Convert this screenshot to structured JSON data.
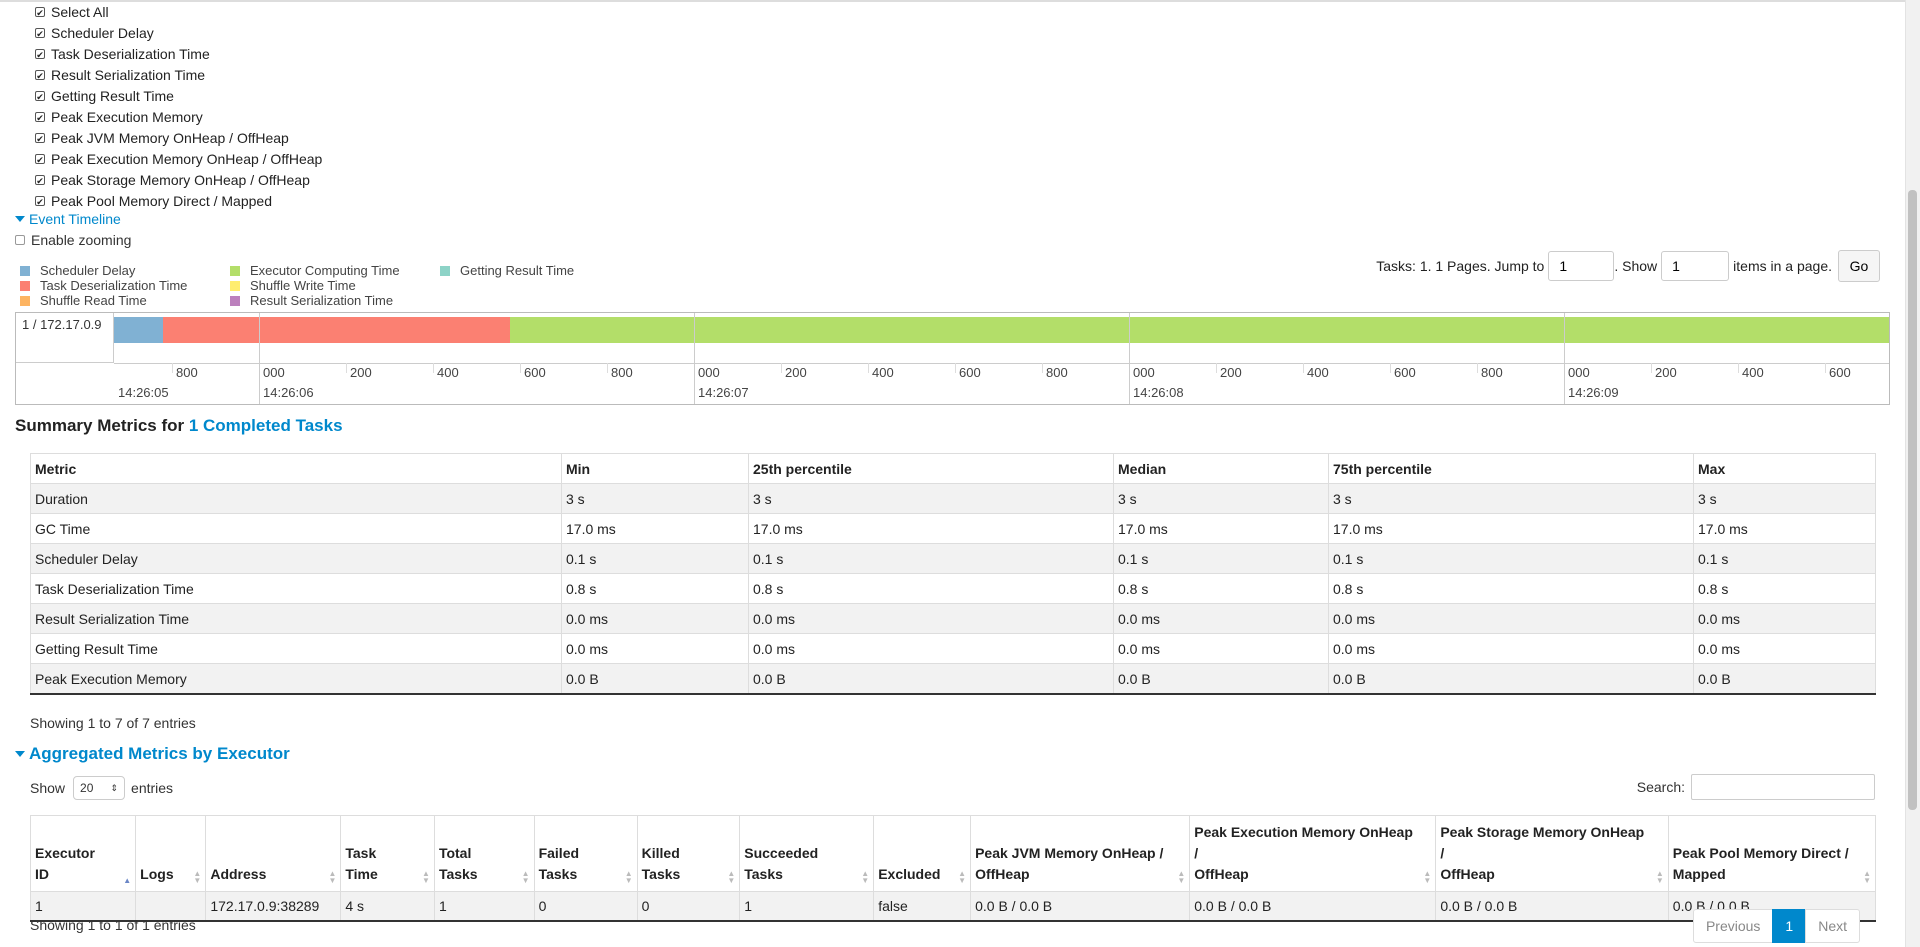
{
  "checkboxes": [
    "Select All",
    "Scheduler Delay",
    "Task Deserialization Time",
    "Result Serialization Time",
    "Getting Result Time",
    "Peak Execution Memory",
    "Peak JVM Memory OnHeap / OffHeap",
    "Peak Execution Memory OnHeap / OffHeap",
    "Peak Storage Memory OnHeap / OffHeap",
    "Peak Pool Memory Direct / Mapped"
  ],
  "event_timeline_label": "Event Timeline",
  "enable_zooming_label": "Enable zooming",
  "legend": [
    {
      "label": "Scheduler Delay",
      "color": "#80b1d3"
    },
    {
      "label": "Task Deserialization Time",
      "color": "#fb8072"
    },
    {
      "label": "Shuffle Read Time",
      "color": "#fdb462"
    },
    {
      "label": "Executor Computing Time",
      "color": "#b3de69"
    },
    {
      "label": "Shuffle Write Time",
      "color": "#ffed6f"
    },
    {
      "label": "Result Serialization Time",
      "color": "#bc80bd"
    },
    {
      "label": "Getting Result Time",
      "color": "#8dd3c7"
    }
  ],
  "pager": {
    "text1": "Tasks: 1. 1 Pages. Jump to",
    "page_value": "1",
    "text2": ". Show",
    "show_value": "1",
    "text3": "items in a page.",
    "go": "Go"
  },
  "timeline": {
    "row_label": "1 / 172.17.0.9",
    "ticks": [
      "800",
      "000",
      "200",
      "400",
      "600",
      "800",
      "000",
      "200",
      "400",
      "600",
      "800",
      "000",
      "200",
      "400",
      "600",
      "800",
      "000",
      "200",
      "400",
      "600"
    ],
    "major_labels": [
      "14:26:05",
      "14:26:06",
      "14:26:07",
      "14:26:08",
      "14:26:09"
    ]
  },
  "summary": {
    "title_prefix": "Summary Metrics for ",
    "title_link": "1 Completed Tasks"
  },
  "metrics_table": {
    "headers": [
      "Metric",
      "Min",
      "25th percentile",
      "Median",
      "75th percentile",
      "Max"
    ],
    "rows": [
      [
        "Duration",
        "3 s",
        "3 s",
        "3 s",
        "3 s",
        "3 s"
      ],
      [
        "GC Time",
        "17.0 ms",
        "17.0 ms",
        "17.0 ms",
        "17.0 ms",
        "17.0 ms"
      ],
      [
        "Scheduler Delay",
        "0.1 s",
        "0.1 s",
        "0.1 s",
        "0.1 s",
        "0.1 s"
      ],
      [
        "Task Deserialization Time",
        "0.8 s",
        "0.8 s",
        "0.8 s",
        "0.8 s",
        "0.8 s"
      ],
      [
        "Result Serialization Time",
        "0.0 ms",
        "0.0 ms",
        "0.0 ms",
        "0.0 ms",
        "0.0 ms"
      ],
      [
        "Getting Result Time",
        "0.0 ms",
        "0.0 ms",
        "0.0 ms",
        "0.0 ms",
        "0.0 ms"
      ],
      [
        "Peak Execution Memory",
        "0.0 B",
        "0.0 B",
        "0.0 B",
        "0.0 B",
        "0.0 B"
      ]
    ],
    "info": "Showing 1 to 7 of 7 entries"
  },
  "aggregated": {
    "title": "Aggregated Metrics by Executor",
    "show_label": "Show",
    "show_value": "20",
    "entries_label": "entries",
    "search_label": "Search:",
    "headers": [
      [
        "Executor",
        "ID"
      ],
      [
        "Logs"
      ],
      [
        "Address"
      ],
      [
        "Task",
        "Time"
      ],
      [
        "Total",
        "Tasks"
      ],
      [
        "Failed",
        "Tasks"
      ],
      [
        "Killed",
        "Tasks"
      ],
      [
        "Succeeded",
        "Tasks"
      ],
      [
        "Excluded"
      ],
      [
        "Peak JVM Memory OnHeap /",
        "OffHeap"
      ],
      [
        "Peak Execution Memory OnHeap /",
        "OffHeap"
      ],
      [
        "Peak Storage Memory OnHeap /",
        "OffHeap"
      ],
      [
        "Peak Pool Memory Direct /",
        "Mapped"
      ]
    ],
    "row": [
      "1",
      "",
      "172.17.0.9:38289",
      "4 s",
      "1",
      "0",
      "0",
      "1",
      "false",
      "0.0 B / 0.0 B",
      "0.0 B / 0.0 B",
      "0.0 B / 0.0 B",
      "0.0 B / 0.0 B"
    ],
    "info": "Showing 1 to 1 of 1 entries",
    "pagination": {
      "previous": "Previous",
      "current": "1",
      "next": "Next"
    }
  }
}
